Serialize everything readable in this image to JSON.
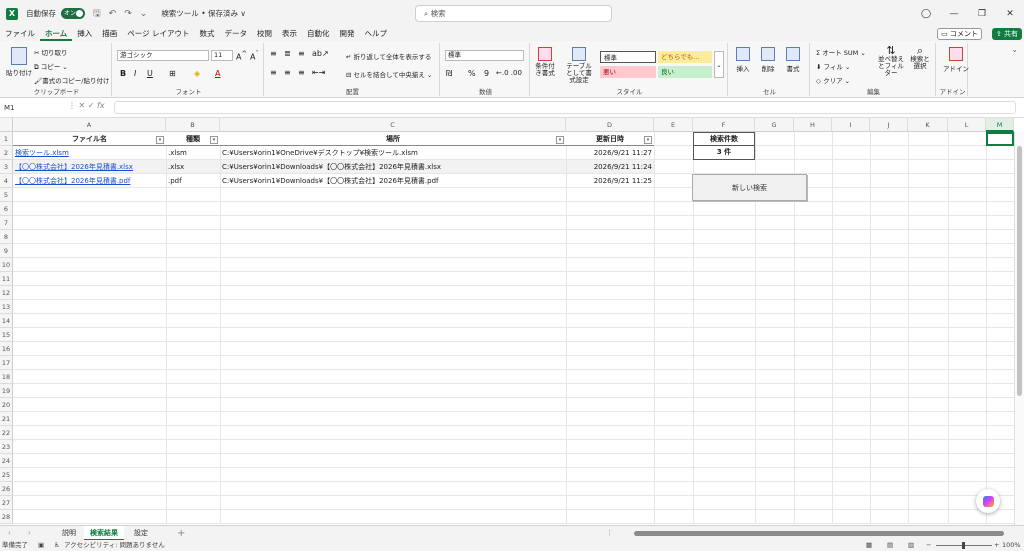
{
  "titlebar": {
    "autosave_label": "自動保存",
    "autosave_state": "オン",
    "doc_title": "検索ツール • 保存済み ∨",
    "search_placeholder": "検索"
  },
  "menu": {
    "items": [
      "ファイル",
      "ホーム",
      "挿入",
      "描画",
      "ページ レイアウト",
      "数式",
      "データ",
      "校閲",
      "表示",
      "自動化",
      "開発",
      "ヘルプ"
    ],
    "active": "ホーム",
    "comment_label": "コメント",
    "share_label": "共有"
  },
  "ribbon": {
    "clipboard": {
      "paste": "貼り付け",
      "cut": "切り取り",
      "copy": "コピー",
      "format_painter": "書式のコピー/貼り付け",
      "label": "クリップボード"
    },
    "font": {
      "name": "游ゴシック",
      "size": "11",
      "label": "フォント"
    },
    "alignment": {
      "wrap": "折り返して全体を表示する",
      "merge": "セルを結合して中央揃え",
      "label": "配置"
    },
    "number": {
      "format": "標準",
      "label": "数値"
    },
    "styles": {
      "conditional": "条件付き書式",
      "table": "テーブルとして書式設定",
      "normal": "標準",
      "neutral": "どちらでも...",
      "bad": "悪い",
      "good": "良い",
      "label": "スタイル"
    },
    "cells": {
      "insert": "挿入",
      "delete": "削除",
      "format": "書式",
      "label": "セル"
    },
    "editing": {
      "autosum": "オート SUM",
      "fill": "フィル",
      "clear": "クリア",
      "sort": "並べ替えとフィルター",
      "find": "検索と選択",
      "label": "編集"
    },
    "addins": {
      "label": "アドイン",
      "btn": "アドイン"
    }
  },
  "formula_bar": {
    "name_box": "M1",
    "fx": "fx",
    "value": ""
  },
  "columns": [
    "A",
    "B",
    "C",
    "D",
    "E",
    "F",
    "G",
    "H",
    "I",
    "J",
    "K",
    "L",
    "M"
  ],
  "rows": [
    "1",
    "2",
    "3",
    "4",
    "5",
    "6",
    "7",
    "8",
    "9",
    "10",
    "11",
    "12",
    "13",
    "14",
    "15",
    "16",
    "17",
    "18",
    "19",
    "20",
    "21",
    "22",
    "23",
    "24",
    "25",
    "26",
    "27",
    "28"
  ],
  "table": {
    "headers": [
      "ファイル名",
      "種類",
      "場所",
      "更新日時"
    ],
    "rows": [
      {
        "name": "検索ツール.xlsm",
        "type": ".xlsm",
        "path": "C:¥Users¥orin1¥OneDrive¥デスクトップ¥検索ツール.xlsm",
        "date": "2026/9/21 11:27"
      },
      {
        "name": "【〇〇株式会社】2026年見積書.xlsx",
        "type": ".xlsx",
        "path": "C:¥Users¥orin1¥Downloads¥【〇〇株式会社】2026年見積書.xlsx",
        "date": "2026/9/21 11:24"
      },
      {
        "name": "【〇〇株式会社】2026年見積書.pdf",
        "type": ".pdf",
        "path": "C:¥Users¥orin1¥Downloads¥【〇〇株式会社】2026年見積書.pdf",
        "date": "2026/9/21 11:25"
      }
    ]
  },
  "summary": {
    "label": "検索件数",
    "value": "3 件",
    "new_search": "新しい検索"
  },
  "sheets": {
    "tabs": [
      "説明",
      "検索結果",
      "設定"
    ],
    "active": "検索結果"
  },
  "status": {
    "ready": "準備完了",
    "accessibility": "アクセシビリティ: 問題ありません",
    "zoom": "100%"
  },
  "colors": {
    "excel_green": "#107c41",
    "link_blue": "#1f4fd1",
    "bad_fill": "#ffc7ce",
    "good_fill": "#c6efce",
    "neutral_fill": "#ffeb9c"
  }
}
